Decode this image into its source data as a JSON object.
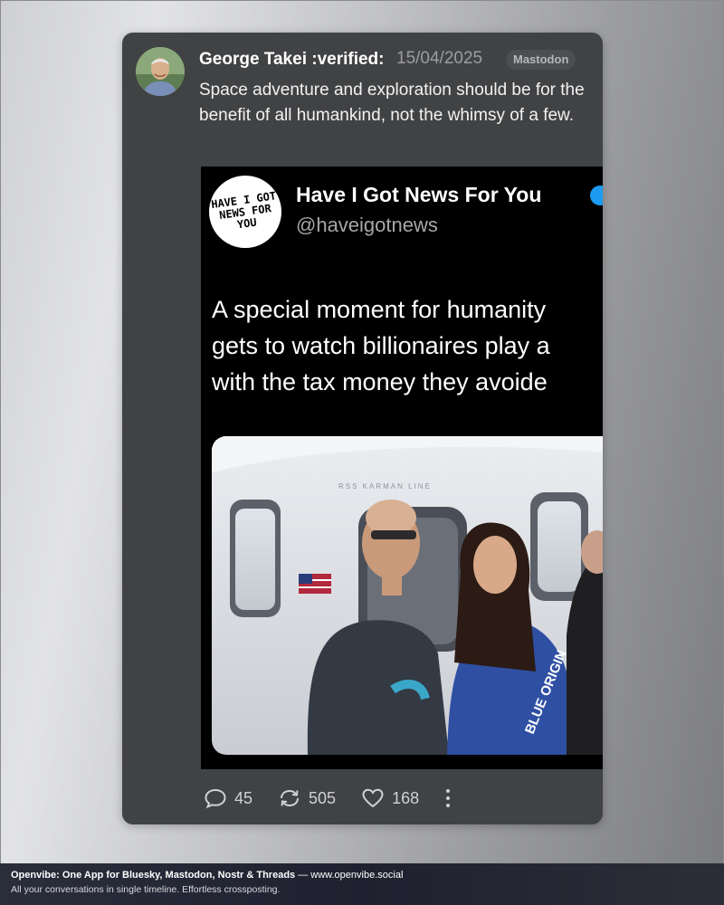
{
  "post": {
    "author": "George Takei :verified:",
    "timestamp": "15/04/2025",
    "network": "Mastodon",
    "text": "Space adventure and exploration should be for the benefit of all humankind, not the whimsy of a few.",
    "embed": {
      "avatar_text": "HAVE I GOT NEWS FOR YOU",
      "name": "Have I Got News For You",
      "handle": "@haveigotnews",
      "lines": [
        "A special moment for humanity",
        "gets to watch billionaires play a",
        "with the tax money they avoide"
      ],
      "photo_texts": {
        "capsule": "RSS KARMAN LINE",
        "suit": "BLUE ORIGIN"
      }
    },
    "stats": {
      "replies": "45",
      "boosts": "505",
      "likes": "168"
    }
  },
  "icons": {
    "reply": "speech-bubble-icon",
    "boost": "repeat-arrows-icon",
    "like": "heart-icon",
    "more": "vertical-dots-icon"
  },
  "footer": {
    "brand": "Openvibe: One App for Bluesky, Mastodon, Nostr & Threads",
    "separator": " — ",
    "url": "www.openvibe.social",
    "tagline": "All your conversations in single timeline. Effortless crossposting."
  },
  "colors": {
    "card_bg": "#414244",
    "accent_verified": "#1d9bf0",
    "footer_bg": "#23252f"
  }
}
